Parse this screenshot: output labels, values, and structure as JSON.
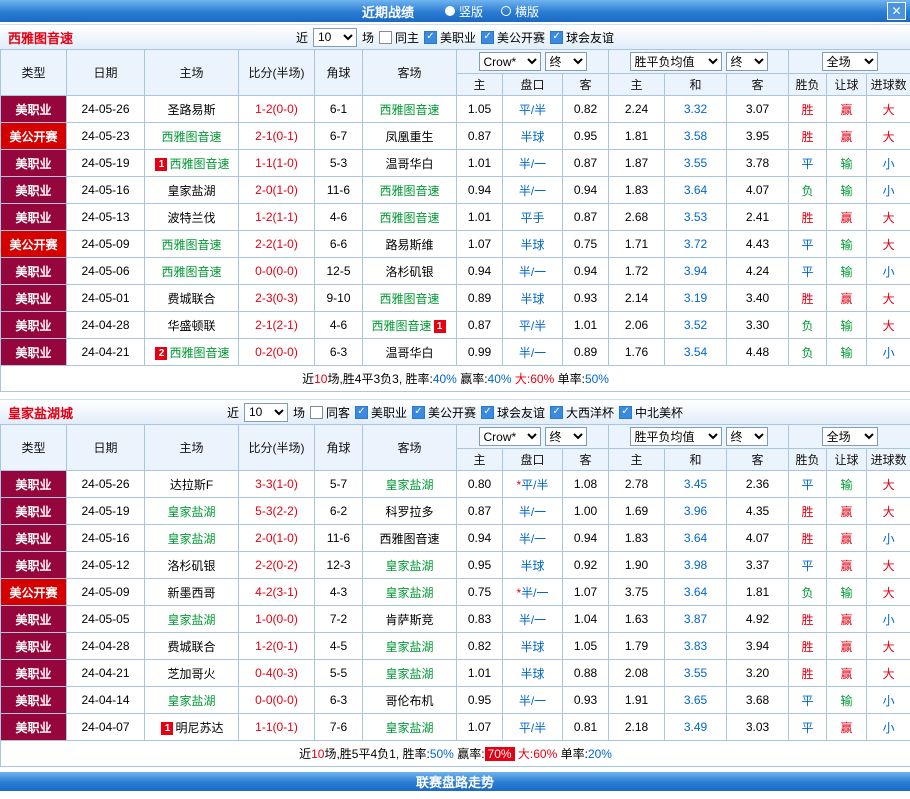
{
  "header": {
    "title": "近期战绩",
    "options": [
      {
        "label": "竖版",
        "selected": true
      },
      {
        "label": "横版",
        "selected": false
      }
    ],
    "close_icon": "✕"
  },
  "columns": {
    "base": [
      "类型",
      "日期",
      "主场",
      "比分(半场)",
      "角球",
      "客场"
    ],
    "provider": "Crow*",
    "final": "终",
    "avg": "胜平负均值",
    "scope": "全场",
    "sub": [
      "主",
      "盘口",
      "客",
      "主",
      "和",
      "客",
      "胜负",
      "让球",
      "进球数"
    ]
  },
  "sections": [
    {
      "team": "西雅图音速",
      "filter": {
        "near": "近",
        "count": "10",
        "unit": "场",
        "same": {
          "label": "同主",
          "checked": false
        },
        "leagues": [
          {
            "label": "美职业",
            "checked": true
          },
          {
            "label": "美公开赛",
            "checked": true
          },
          {
            "label": "球会友谊",
            "checked": true
          }
        ]
      },
      "rows": [
        {
          "type": "美职业",
          "tcls": "mls",
          "date": "24-05-26",
          "home": {
            "name": "圣路易斯"
          },
          "score": "1-2(0-0)",
          "corner": "6-1",
          "away": {
            "name": "西雅图音速",
            "green": true
          },
          "crown": [
            "1.05",
            "平/半",
            "0.82"
          ],
          "avg": [
            "2.24",
            "3.32",
            "3.07"
          ],
          "res": [
            [
              "胜",
              "r"
            ],
            [
              "赢",
              "r"
            ],
            [
              "大",
              "r"
            ]
          ]
        },
        {
          "type": "美公开赛",
          "tcls": "open",
          "date": "24-05-23",
          "home": {
            "name": "西雅图音速",
            "green": true
          },
          "score": "2-1(0-1)",
          "corner": "6-7",
          "away": {
            "name": "凤凰重生"
          },
          "crown": [
            "0.87",
            "半球",
            "0.95"
          ],
          "avg": [
            "1.81",
            "3.58",
            "3.95"
          ],
          "res": [
            [
              "胜",
              "r"
            ],
            [
              "赢",
              "r"
            ],
            [
              "大",
              "r"
            ]
          ]
        },
        {
          "type": "美职业",
          "tcls": "mls",
          "date": "24-05-19",
          "home": {
            "name": "西雅图音速",
            "green": true,
            "badge": "1",
            "side": "left"
          },
          "score": "1-1(1-0)",
          "corner": "5-3",
          "away": {
            "name": "温哥华白"
          },
          "crown": [
            "1.01",
            "半/一",
            "0.87"
          ],
          "avg": [
            "1.87",
            "3.55",
            "3.78"
          ],
          "res": [
            [
              "平",
              "b"
            ],
            [
              "输",
              "g"
            ],
            [
              "小",
              "b"
            ]
          ]
        },
        {
          "type": "美职业",
          "tcls": "mls",
          "date": "24-05-16",
          "home": {
            "name": "皇家盐湖"
          },
          "score": "2-0(1-0)",
          "corner": "11-6",
          "away": {
            "name": "西雅图音速",
            "green": true
          },
          "crown": [
            "0.94",
            "半/一",
            "0.94"
          ],
          "avg": [
            "1.83",
            "3.64",
            "4.07"
          ],
          "res": [
            [
              "负",
              "g"
            ],
            [
              "输",
              "g"
            ],
            [
              "小",
              "b"
            ]
          ]
        },
        {
          "type": "美职业",
          "tcls": "mls",
          "date": "24-05-13",
          "home": {
            "name": "波特兰伐"
          },
          "score": "1-2(1-1)",
          "corner": "4-6",
          "away": {
            "name": "西雅图音速",
            "green": true
          },
          "crown": [
            "1.01",
            "平手",
            "0.87"
          ],
          "avg": [
            "2.68",
            "3.53",
            "2.41"
          ],
          "res": [
            [
              "胜",
              "r"
            ],
            [
              "赢",
              "r"
            ],
            [
              "大",
              "r"
            ]
          ]
        },
        {
          "type": "美公开赛",
          "tcls": "open",
          "date": "24-05-09",
          "home": {
            "name": "西雅图音速",
            "green": true
          },
          "score": "2-2(1-0)",
          "corner": "6-6",
          "away": {
            "name": "路易斯维"
          },
          "crown": [
            "1.07",
            "半球",
            "0.75"
          ],
          "avg": [
            "1.71",
            "3.72",
            "4.43"
          ],
          "res": [
            [
              "平",
              "b"
            ],
            [
              "输",
              "g"
            ],
            [
              "大",
              "r"
            ]
          ]
        },
        {
          "type": "美职业",
          "tcls": "mls",
          "date": "24-05-06",
          "home": {
            "name": "西雅图音速",
            "green": true
          },
          "score": "0-0(0-0)",
          "corner": "12-5",
          "away": {
            "name": "洛杉矶银"
          },
          "crown": [
            "0.94",
            "半/一",
            "0.94"
          ],
          "avg": [
            "1.72",
            "3.94",
            "4.24"
          ],
          "res": [
            [
              "平",
              "b"
            ],
            [
              "输",
              "g"
            ],
            [
              "小",
              "b"
            ]
          ]
        },
        {
          "type": "美职业",
          "tcls": "mls",
          "date": "24-05-01",
          "home": {
            "name": "费城联合"
          },
          "score": "2-3(0-3)",
          "corner": "9-10",
          "away": {
            "name": "西雅图音速",
            "green": true
          },
          "crown": [
            "0.89",
            "半球",
            "0.93"
          ],
          "avg": [
            "2.14",
            "3.19",
            "3.40"
          ],
          "res": [
            [
              "胜",
              "r"
            ],
            [
              "赢",
              "r"
            ],
            [
              "大",
              "r"
            ]
          ]
        },
        {
          "type": "美职业",
          "tcls": "mls",
          "date": "24-04-28",
          "home": {
            "name": "华盛顿联"
          },
          "score": "2-1(2-1)",
          "corner": "4-6",
          "away": {
            "name": "西雅图音速",
            "green": true,
            "badge": "1",
            "side": "right"
          },
          "crown": [
            "0.87",
            "平/半",
            "1.01"
          ],
          "avg": [
            "2.06",
            "3.52",
            "3.30"
          ],
          "res": [
            [
              "负",
              "g"
            ],
            [
              "输",
              "g"
            ],
            [
              "大",
              "r"
            ]
          ]
        },
        {
          "type": "美职业",
          "tcls": "mls",
          "date": "24-04-21",
          "home": {
            "name": "西雅图音速",
            "green": true,
            "badge": "2",
            "side": "left"
          },
          "score": "0-2(0-0)",
          "corner": "6-3",
          "away": {
            "name": "温哥华白"
          },
          "crown": [
            "0.99",
            "半/一",
            "0.89"
          ],
          "avg": [
            "1.76",
            "3.54",
            "4.48"
          ],
          "res": [
            [
              "负",
              "g"
            ],
            [
              "输",
              "g"
            ],
            [
              "小",
              "b"
            ]
          ]
        }
      ],
      "summary": [
        [
          "近",
          "k"
        ],
        [
          "10",
          "r"
        ],
        [
          "场,胜4平3负3, 胜率:",
          "k"
        ],
        [
          "40%",
          "b"
        ],
        [
          " 赢率:",
          "k"
        ],
        [
          "40%",
          "b"
        ],
        [
          " 大:",
          "r"
        ],
        [
          "60%",
          "r"
        ],
        [
          " 单率:",
          "k"
        ],
        [
          "50%",
          "b"
        ]
      ]
    },
    {
      "team": "皇家盐湖城",
      "filter": {
        "near": "近",
        "count": "10",
        "unit": "场",
        "same": {
          "label": "同客",
          "checked": false
        },
        "leagues": [
          {
            "label": "美职业",
            "checked": true
          },
          {
            "label": "美公开赛",
            "checked": true
          },
          {
            "label": "球会友谊",
            "checked": true
          },
          {
            "label": "大西洋杯",
            "checked": true
          },
          {
            "label": "中北美杯",
            "checked": true
          }
        ]
      },
      "rows": [
        {
          "type": "美职业",
          "tcls": "mls",
          "date": "24-05-26",
          "home": {
            "name": "达拉斯F"
          },
          "score": "3-3(1-0)",
          "corner": "5-7",
          "away": {
            "name": "皇家盐湖",
            "green": true
          },
          "crown": [
            "0.80",
            "平/半",
            "1.08"
          ],
          "star": true,
          "avg": [
            "2.78",
            "3.45",
            "2.36"
          ],
          "res": [
            [
              "平",
              "b"
            ],
            [
              "输",
              "g"
            ],
            [
              "大",
              "r"
            ]
          ]
        },
        {
          "type": "美职业",
          "tcls": "mls",
          "date": "24-05-19",
          "home": {
            "name": "皇家盐湖",
            "green": true
          },
          "score": "5-3(2-2)",
          "corner": "6-2",
          "away": {
            "name": "科罗拉多"
          },
          "crown": [
            "0.87",
            "半/一",
            "1.00"
          ],
          "avg": [
            "1.69",
            "3.96",
            "4.35"
          ],
          "res": [
            [
              "胜",
              "r"
            ],
            [
              "赢",
              "r"
            ],
            [
              "大",
              "r"
            ]
          ]
        },
        {
          "type": "美职业",
          "tcls": "mls",
          "date": "24-05-16",
          "home": {
            "name": "皇家盐湖",
            "green": true
          },
          "score": "2-0(1-0)",
          "corner": "11-6",
          "away": {
            "name": "西雅图音速"
          },
          "crown": [
            "0.94",
            "半/一",
            "0.94"
          ],
          "avg": [
            "1.83",
            "3.64",
            "4.07"
          ],
          "res": [
            [
              "胜",
              "r"
            ],
            [
              "赢",
              "r"
            ],
            [
              "小",
              "b"
            ]
          ]
        },
        {
          "type": "美职业",
          "tcls": "mls",
          "date": "24-05-12",
          "home": {
            "name": "洛杉矶银"
          },
          "score": "2-2(0-2)",
          "corner": "12-3",
          "away": {
            "name": "皇家盐湖",
            "green": true
          },
          "crown": [
            "0.95",
            "半球",
            "0.92"
          ],
          "avg": [
            "1.90",
            "3.98",
            "3.37"
          ],
          "res": [
            [
              "平",
              "b"
            ],
            [
              "赢",
              "r"
            ],
            [
              "大",
              "r"
            ]
          ]
        },
        {
          "type": "美公开赛",
          "tcls": "open",
          "date": "24-05-09",
          "home": {
            "name": "新墨西哥"
          },
          "score": "4-2(3-1)",
          "corner": "4-3",
          "away": {
            "name": "皇家盐湖",
            "green": true
          },
          "crown": [
            "0.75",
            "半/一",
            "1.07"
          ],
          "star": true,
          "avg": [
            "3.75",
            "3.64",
            "1.81"
          ],
          "res": [
            [
              "负",
              "g"
            ],
            [
              "输",
              "g"
            ],
            [
              "大",
              "r"
            ]
          ]
        },
        {
          "type": "美职业",
          "tcls": "mls",
          "date": "24-05-05",
          "home": {
            "name": "皇家盐湖",
            "green": true
          },
          "score": "1-0(0-0)",
          "corner": "7-2",
          "away": {
            "name": "肯萨斯竞"
          },
          "crown": [
            "0.83",
            "半/一",
            "1.04"
          ],
          "avg": [
            "1.63",
            "3.87",
            "4.92"
          ],
          "res": [
            [
              "胜",
              "r"
            ],
            [
              "赢",
              "r"
            ],
            [
              "小",
              "b"
            ]
          ]
        },
        {
          "type": "美职业",
          "tcls": "mls",
          "date": "24-04-28",
          "home": {
            "name": "费城联合"
          },
          "score": "1-2(0-1)",
          "corner": "4-5",
          "away": {
            "name": "皇家盐湖",
            "green": true
          },
          "crown": [
            "0.82",
            "半球",
            "1.05"
          ],
          "avg": [
            "1.79",
            "3.83",
            "3.94"
          ],
          "res": [
            [
              "胜",
              "r"
            ],
            [
              "赢",
              "r"
            ],
            [
              "大",
              "r"
            ]
          ]
        },
        {
          "type": "美职业",
          "tcls": "mls",
          "date": "24-04-21",
          "home": {
            "name": "芝加哥火"
          },
          "score": "0-4(0-3)",
          "corner": "5-5",
          "away": {
            "name": "皇家盐湖",
            "green": true
          },
          "crown": [
            "1.01",
            "半球",
            "0.88"
          ],
          "avg": [
            "2.08",
            "3.55",
            "3.20"
          ],
          "res": [
            [
              "胜",
              "r"
            ],
            [
              "赢",
              "r"
            ],
            [
              "大",
              "r"
            ]
          ]
        },
        {
          "type": "美职业",
          "tcls": "mls",
          "date": "24-04-14",
          "home": {
            "name": "皇家盐湖",
            "green": true
          },
          "score": "0-0(0-0)",
          "corner": "6-3",
          "away": {
            "name": "哥伦布机"
          },
          "crown": [
            "0.95",
            "半/一",
            "0.93"
          ],
          "avg": [
            "1.91",
            "3.65",
            "3.68"
          ],
          "res": [
            [
              "平",
              "b"
            ],
            [
              "输",
              "g"
            ],
            [
              "小",
              "b"
            ]
          ]
        },
        {
          "type": "美职业",
          "tcls": "mls",
          "date": "24-04-07",
          "home": {
            "name": "明尼苏达",
            "badge": "1",
            "side": "left"
          },
          "score": "1-1(0-1)",
          "corner": "7-6",
          "away": {
            "name": "皇家盐湖",
            "green": true
          },
          "crown": [
            "1.07",
            "平/半",
            "0.81"
          ],
          "avg": [
            "2.18",
            "3.49",
            "3.03"
          ],
          "res": [
            [
              "平",
              "b"
            ],
            [
              "赢",
              "r"
            ],
            [
              "小",
              "b"
            ]
          ]
        }
      ],
      "summary": [
        [
          "近",
          "k"
        ],
        [
          "10",
          "r"
        ],
        [
          "场,胜5平4负1, 胜率:",
          "k"
        ],
        [
          "50%",
          "b"
        ],
        [
          " 赢率:",
          "k"
        ],
        [
          "70%",
          "hl"
        ],
        [
          " 大:",
          "r"
        ],
        [
          "60%",
          "r"
        ],
        [
          " 单率:",
          "k"
        ],
        [
          "20%",
          "b"
        ]
      ]
    }
  ],
  "footer": {
    "title": "联赛盘路走势"
  }
}
